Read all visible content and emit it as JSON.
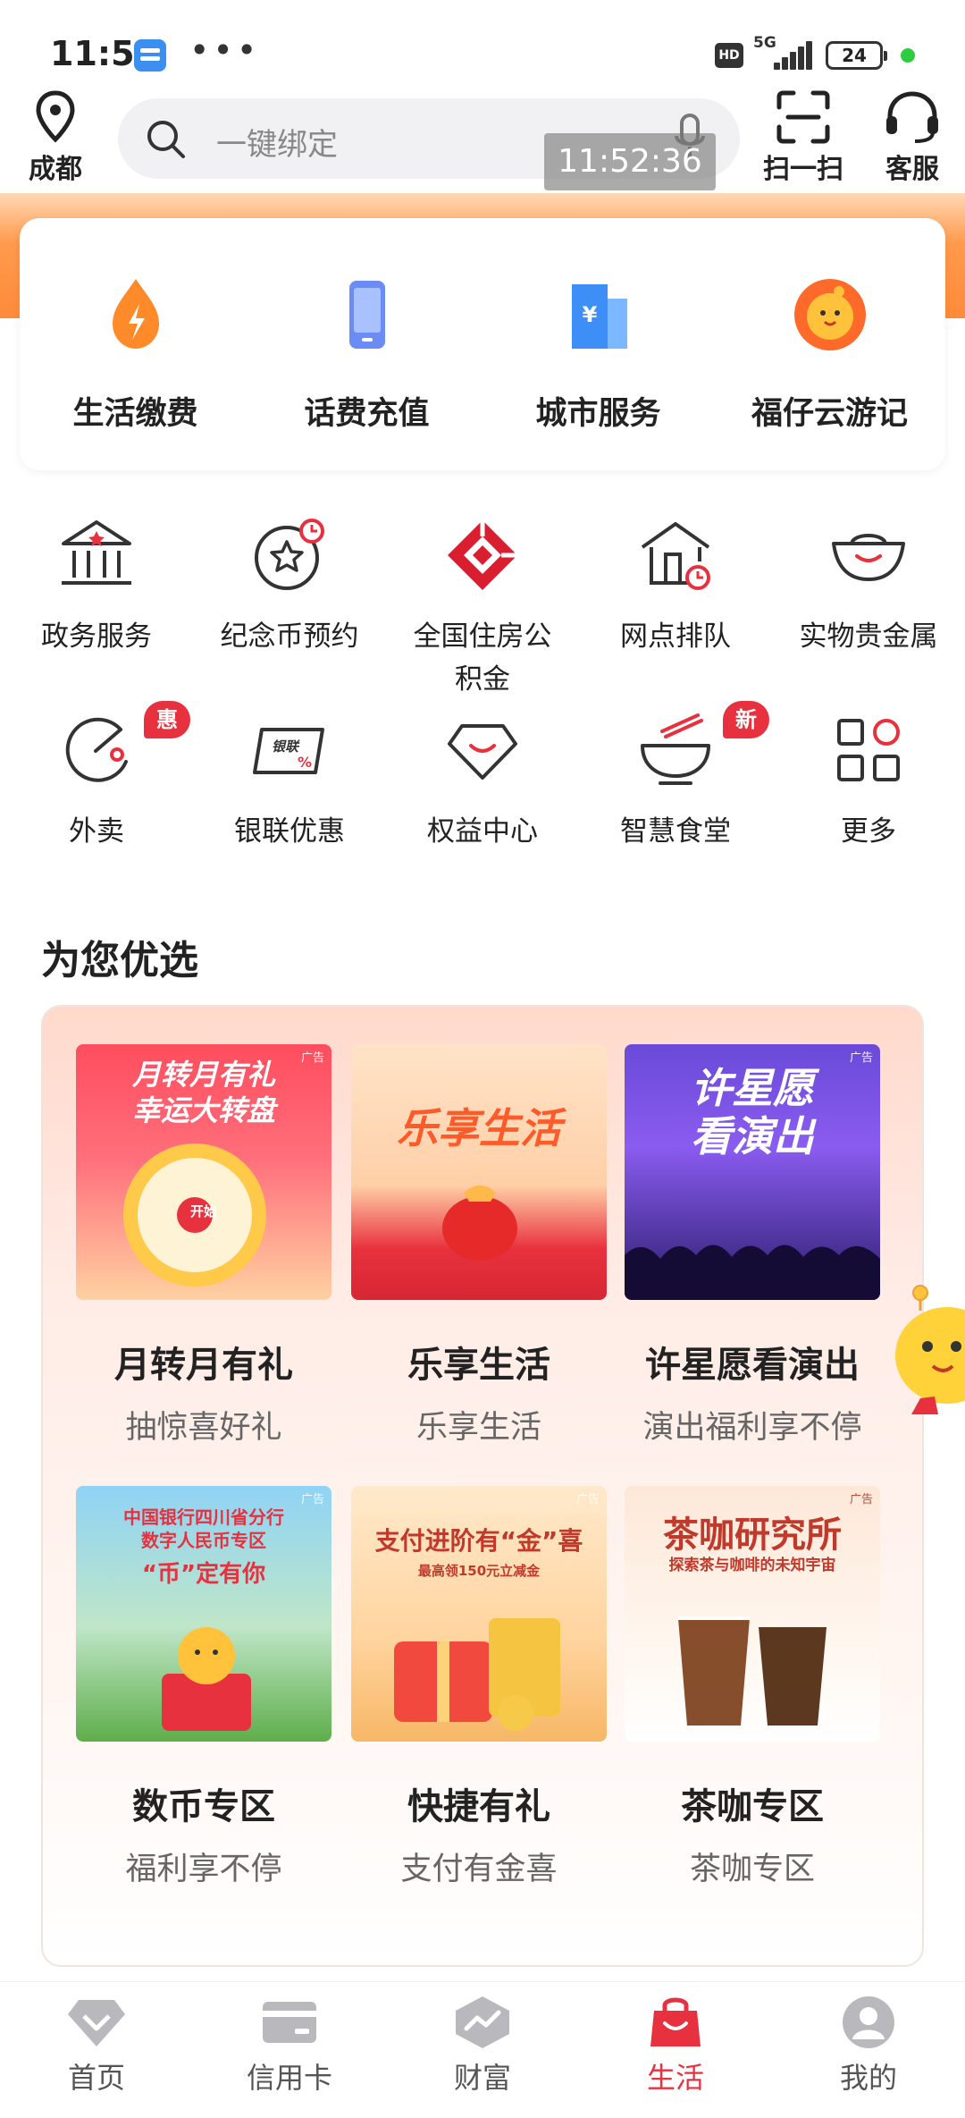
{
  "status_bar": {
    "time": "11:52",
    "dots": "•••",
    "hd": "HD",
    "network": "5G",
    "battery": "24"
  },
  "header": {
    "location": "成都",
    "search_placeholder": "一键绑定",
    "scan_label": "扫一扫",
    "service_label": "客服",
    "timestamp_overlay": "11:52:36"
  },
  "top_services": [
    {
      "label": "生活缴费",
      "icon": "flame-drop-icon"
    },
    {
      "label": "话费充值",
      "icon": "phone-icon"
    },
    {
      "label": "城市服务",
      "icon": "building-icon"
    },
    {
      "label": "福仔云游记",
      "icon": "mascot-icon"
    }
  ],
  "services": [
    {
      "label": "政务服务",
      "icon": "government-building-icon"
    },
    {
      "label": "纪念币预约",
      "icon": "coin-clock-icon"
    },
    {
      "label": "全国住房公积金",
      "icon": "housing-fund-icon"
    },
    {
      "label": "网点排队",
      "icon": "branch-queue-icon"
    },
    {
      "label": "实物贵金属",
      "icon": "gold-ingot-icon"
    },
    {
      "label": "外卖",
      "icon": "takeout-icon",
      "badge": "惠"
    },
    {
      "label": "银联优惠",
      "icon": "unionpay-card-icon"
    },
    {
      "label": "权益中心",
      "icon": "diamond-icon"
    },
    {
      "label": "智慧食堂",
      "icon": "bowl-icon",
      "badge": "新"
    },
    {
      "label": "更多",
      "icon": "grid-icon"
    }
  ],
  "section": {
    "title": "为您优选",
    "ad_tag": "广告"
  },
  "promos": [
    {
      "title": "月转月有礼",
      "subtitle": "抽惊喜好礼",
      "img_text": "月转月有礼\n幸运大转盘",
      "img_sub": "开始"
    },
    {
      "title": "乐享生活",
      "subtitle": "乐享生活",
      "img_text": "乐享生活"
    },
    {
      "title": "许星愿看演出",
      "subtitle": "演出福利享不停",
      "img_text": "许星愿\n看演出"
    },
    {
      "title": "数币专区",
      "subtitle": "福利享不停",
      "img_text": "中国银行四川省分行\n数字人民币专区",
      "img_sub": "“币”定有你"
    },
    {
      "title": "快捷有礼",
      "subtitle": "支付有金喜",
      "img_text": "支付进阶有“金”喜",
      "img_sub": "最高领150元立减金"
    },
    {
      "title": "茶咖专区",
      "subtitle": "茶咖专区",
      "img_text": "茶咖研究所",
      "img_sub": "探索茶与咖啡的未知宇宙"
    }
  ],
  "bottom_nav": [
    {
      "label": "首页"
    },
    {
      "label": "信用卡"
    },
    {
      "label": "财富"
    },
    {
      "label": "生活",
      "active": true
    },
    {
      "label": "我的"
    }
  ],
  "colors": {
    "accent": "#e8313e",
    "orange": "#ff8a3a",
    "text": "#222222"
  }
}
